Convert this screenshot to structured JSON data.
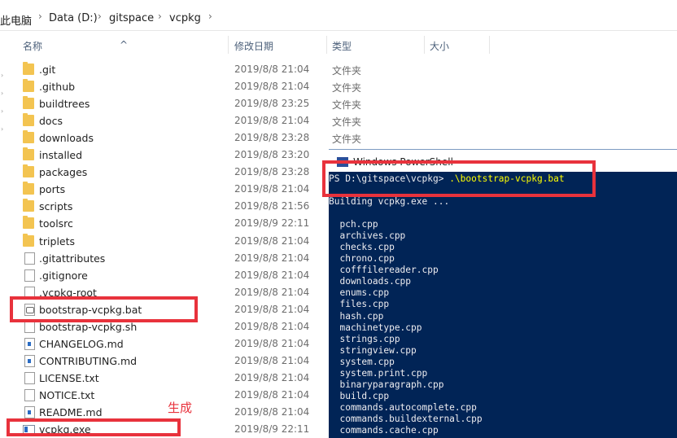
{
  "breadcrumb": [
    "此电脑",
    "Data (D:)",
    "gitspace",
    "vcpkg"
  ],
  "columns": {
    "name": "名称",
    "modified": "修改日期",
    "type": "类型",
    "size": "大小"
  },
  "files": [
    {
      "name": ".git",
      "modified": "2019/8/8 21:04",
      "type": "文件夹",
      "icon": "folder-icon"
    },
    {
      "name": ".github",
      "modified": "2019/8/8 21:04",
      "type": "文件夹",
      "icon": "folder-icon"
    },
    {
      "name": "buildtrees",
      "modified": "2019/8/8 23:25",
      "type": "文件夹",
      "icon": "folder-icon"
    },
    {
      "name": "docs",
      "modified": "2019/8/8 21:04",
      "type": "文件夹",
      "icon": "folder-icon"
    },
    {
      "name": "downloads",
      "modified": "2019/8/8 23:28",
      "type": "文件夹",
      "icon": "folder-icon"
    },
    {
      "name": "installed",
      "modified": "2019/8/8 23:20",
      "type": "",
      "icon": "folder-icon"
    },
    {
      "name": "packages",
      "modified": "2019/8/8 23:28",
      "type": "",
      "icon": "folder-icon"
    },
    {
      "name": "ports",
      "modified": "2019/8/8 21:04",
      "type": "",
      "icon": "folder-icon"
    },
    {
      "name": "scripts",
      "modified": "2019/8/8 21:56",
      "type": "",
      "icon": "folder-icon"
    },
    {
      "name": "toolsrc",
      "modified": "2019/8/9 22:11",
      "type": "",
      "icon": "folder-icon"
    },
    {
      "name": "triplets",
      "modified": "2019/8/8 21:04",
      "type": "",
      "icon": "folder-icon"
    },
    {
      "name": ".gitattributes",
      "modified": "2019/8/8 21:04",
      "type": "",
      "icon": "file-icon"
    },
    {
      "name": ".gitignore",
      "modified": "2019/8/8 21:04",
      "type": "",
      "icon": "file-icon"
    },
    {
      "name": ".vcpkg-root",
      "modified": "2019/8/8 21:04",
      "type": "",
      "icon": "file-icon"
    },
    {
      "name": "bootstrap-vcpkg.bat",
      "modified": "2019/8/8 21:04",
      "type": "",
      "icon": "bat-file-icon"
    },
    {
      "name": "bootstrap-vcpkg.sh",
      "modified": "2019/8/8 21:04",
      "type": "",
      "icon": "file-icon"
    },
    {
      "name": "CHANGELOG.md",
      "modified": "2019/8/8 21:04",
      "type": "",
      "icon": "md-file-icon"
    },
    {
      "name": "CONTRIBUTING.md",
      "modified": "2019/8/8 21:04",
      "type": "",
      "icon": "md-file-icon"
    },
    {
      "name": "LICENSE.txt",
      "modified": "2019/8/8 21:04",
      "type": "",
      "icon": "file-icon"
    },
    {
      "name": "NOTICE.txt",
      "modified": "2019/8/8 21:04",
      "type": "",
      "icon": "file-icon"
    },
    {
      "name": "README.md",
      "modified": "2019/8/8 21:04",
      "type": "",
      "icon": "md-file-icon"
    },
    {
      "name": "vcpkg.exe",
      "modified": "2019/8/9 22:11",
      "type": "",
      "icon": "exe-icon"
    }
  ],
  "annotation": "生成",
  "powershell": {
    "title": "Windows PowerShell",
    "prompt": "PS D:\\gitspace\\vcpkg> ",
    "command": ".\\bootstrap-vcpkg.bat",
    "lines": [
      "Building vcpkg.exe ...",
      "",
      "  pch.cpp",
      "  archives.cpp",
      "  checks.cpp",
      "  chrono.cpp",
      "  cofffilereader.cpp",
      "  downloads.cpp",
      "  enums.cpp",
      "  files.cpp",
      "  hash.cpp",
      "  machinetype.cpp",
      "  strings.cpp",
      "  stringview.cpp",
      "  system.cpp",
      "  system.print.cpp",
      "  binaryparagraph.cpp",
      "  build.cpp",
      "  commands.autocomplete.cpp",
      "  commands.buildexternal.cpp",
      "  commands.cache.cpp"
    ]
  },
  "colors": {
    "highlight": "#e8323c",
    "ps_background": "#012456",
    "ps_command": "#ffff00"
  }
}
